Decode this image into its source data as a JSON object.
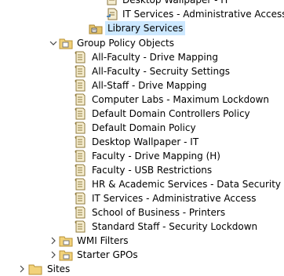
{
  "tree": {
    "top_partial": {
      "label": "Desktop Wallpaper - IT"
    },
    "link_it_admin": {
      "label": "IT Services - Administrative Access"
    },
    "ou_library": {
      "label": "Library Services"
    },
    "gpo_container": {
      "label": "Group Policy Objects",
      "items": [
        "All-Faculty - Drive Mapping",
        "All-Faculty - Secruity Settings",
        "All-Staff - Drive Mapping",
        "Computer Labs - Maximum Lockdown",
        "Default Domain Controllers Policy",
        "Default Domain Policy",
        "Desktop Wallpaper - IT",
        "Faculty - Drive Mapping (H)",
        "Faculty - USB Restrictions",
        "HR & Academic Services - Data Security",
        "IT Services - Administrative Access",
        "School of Business - Printers",
        "Standard Staff - Security Lockdown"
      ]
    },
    "wmi": {
      "label": "WMI Filters"
    },
    "starter": {
      "label": "Starter GPOs"
    },
    "sites": {
      "label": "Sites"
    }
  },
  "colors": {
    "selection": "#cce8ff",
    "folder": "#dcb35c",
    "gpo_scroll": "#e8d9a6"
  }
}
